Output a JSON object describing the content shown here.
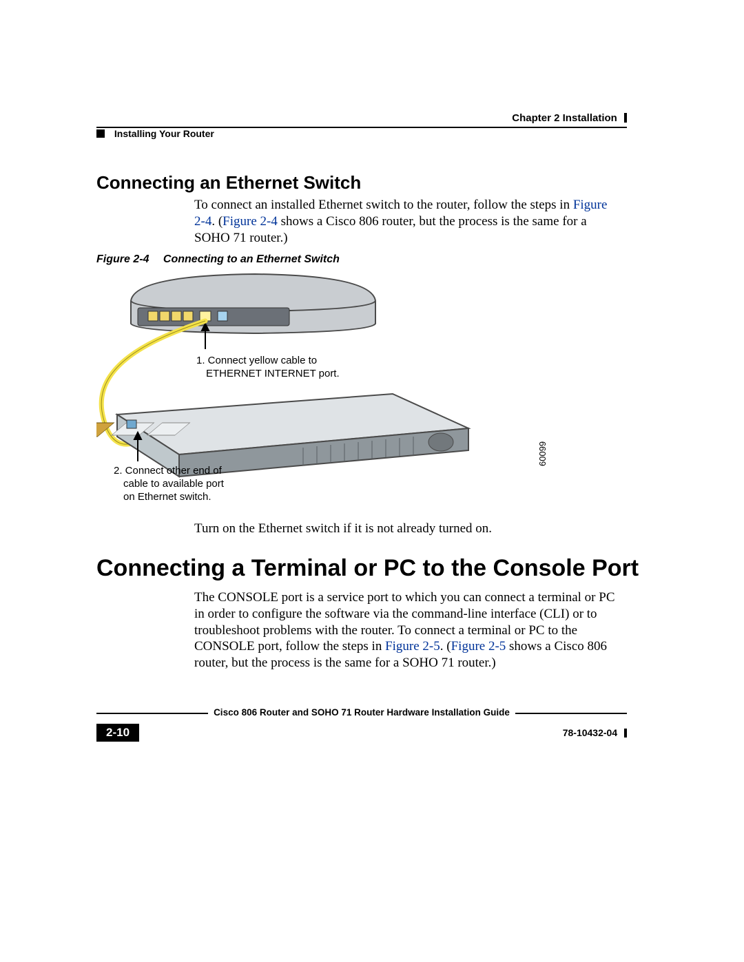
{
  "header": {
    "chapter_label": "Chapter 2",
    "chapter_title": "Installation",
    "section_title": "Installing Your Router"
  },
  "section1": {
    "heading": "Connecting an Ethernet Switch",
    "para_part1": "To connect an installed Ethernet switch to the router, follow the steps in ",
    "figref1": "Figure 2-4",
    "para_part2": ". (",
    "figref2": "Figure 2-4",
    "para_part3": " shows a Cisco 806 router, but the process is the same for a SOHO 71 router.)",
    "figure_label": "Figure 2-4",
    "figure_title": "Connecting to an Ethernet Switch",
    "callout1_line1": "1. Connect yellow cable to",
    "callout1_line2": "ETHERNET INTERNET port.",
    "callout2_line1": "2. Connect other end of",
    "callout2_line2": "cable to available port",
    "callout2_line3": "on Ethernet switch.",
    "figure_id": "60099",
    "turn_on": "Turn on the Ethernet switch if it is not already turned on."
  },
  "section2": {
    "heading": "Connecting a Terminal or PC to the Console Port",
    "para_part1": "The CONSOLE port is a service port to which you can connect a terminal or PC in order to configure the software via the command-line interface (CLI) or to troubleshoot problems with the router. To connect a terminal or PC to the CONSOLE port, follow the steps in ",
    "figref1": "Figure 2-5",
    "para_part2": ". (",
    "figref2": "Figure 2-5",
    "para_part3": " shows a Cisco 806 router, but the process is the same for a SOHO 71 router.)"
  },
  "footer": {
    "book_title": "Cisco 806 Router and SOHO 71 Router Hardware Installation Guide",
    "page_number": "2-10",
    "doc_number": "78-10432-04"
  }
}
